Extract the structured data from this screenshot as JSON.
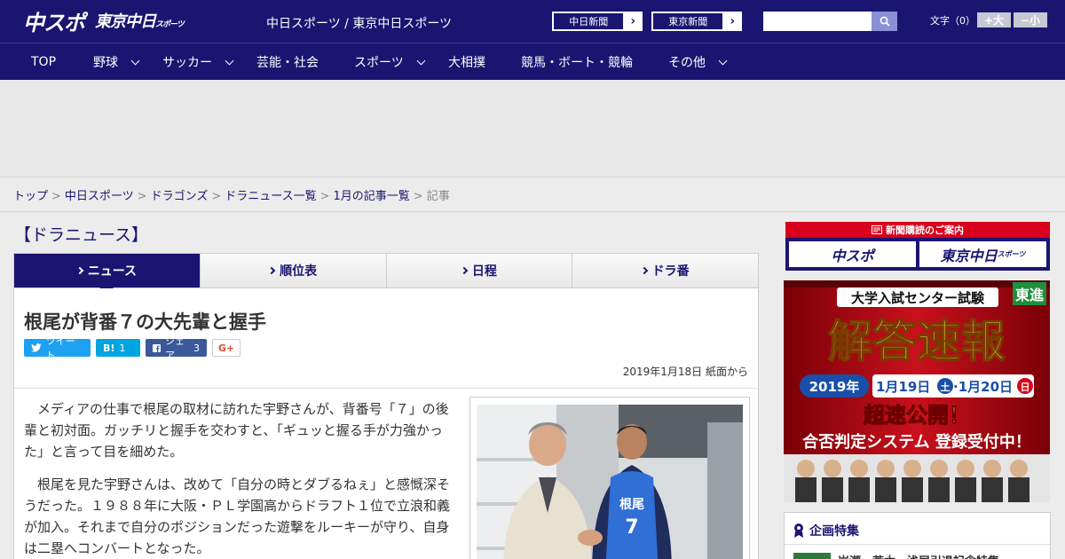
{
  "header": {
    "logo_main": "中スポ",
    "logo_tokyo": "東京中日",
    "logo_tokyo_small": "スポーツ",
    "site_links": "中日スポーツ / 東京中日スポーツ",
    "paper_buttons": [
      {
        "label": "中日新聞"
      },
      {
        "label": "東京新聞"
      }
    ],
    "arrow": "›",
    "search_placeholder": "",
    "font_size_label": "文字（0）",
    "font_bigger": "+大",
    "font_smaller": "−小"
  },
  "nav": {
    "items": [
      {
        "label": "TOP"
      },
      {
        "label": "野球"
      },
      {
        "label": "サッカー"
      },
      {
        "label": "芸能・社会"
      },
      {
        "label": "スポーツ"
      },
      {
        "label": "大相撲"
      },
      {
        "label": "競馬・ボート・競輪"
      },
      {
        "label": "その他"
      }
    ]
  },
  "breadcrumb": {
    "items": [
      "トップ",
      "中日スポーツ",
      "ドラゴンズ",
      "ドラニュース一覧",
      "1月の記事一覧"
    ],
    "current": "記事",
    "separator": ">"
  },
  "section_title": "【ドラニュース】",
  "tabs": [
    {
      "label": "ニュース"
    },
    {
      "label": "順位表"
    },
    {
      "label": "日程"
    },
    {
      "label": "ドラ番"
    }
  ],
  "article": {
    "headline": "根尾が背番７の大先輩と握手",
    "share": {
      "tweet": "ツイート",
      "hatena": "B!",
      "hatena_count": "1",
      "facebook": "シェア",
      "facebook_count": "3",
      "gplus": "G+"
    },
    "date": "2019年1月18日 紙面から",
    "paragraphs": [
      "メディアの仕事で根尾の取材に訪れた宇野さんが、背番号「７」の後輩と初対面。ガッチリと握手を交わすと、「ギュッと握る手が力強かった」と言って目を細めた。",
      "根尾を見た宇野さんは、改めて「自分の時とダブるねぇ」と感慨深そうだった。１９８８年に大阪・ＰＬ学園高からドラフト１位で立浪和義が加入。それまで自分のポジションだった遊撃をルーキーが守り、自身は二塁へコンバートとなった。"
    ],
    "photo_jersey_name": "根尾",
    "photo_jersey_number": "7"
  },
  "sidebar": {
    "subscribe_title": "新聞購読のご案内",
    "subscribe_logos": [
      "中スポ",
      "東京中日"
    ],
    "subscribe_logo_small": "スポーツ",
    "banner": {
      "title": "大学入試センター試験",
      "brand": "東進",
      "headline": "解答速報",
      "year": "2019年",
      "date1": "1月19日",
      "day1": "土",
      "date2": "·1月20日",
      "day2": "日",
      "tagline": "超速公開！",
      "subline": "合否判定システム 登録受付中！"
    },
    "feature_title": "企画特集",
    "feature_item": "岩瀬・荒木・浅尾引退記念特集"
  },
  "colors": {
    "navy": "#1a1570",
    "red": "#d8001c",
    "twitter": "#1da1f2",
    "facebook": "#3b5998",
    "hatena": "#00a4de"
  }
}
